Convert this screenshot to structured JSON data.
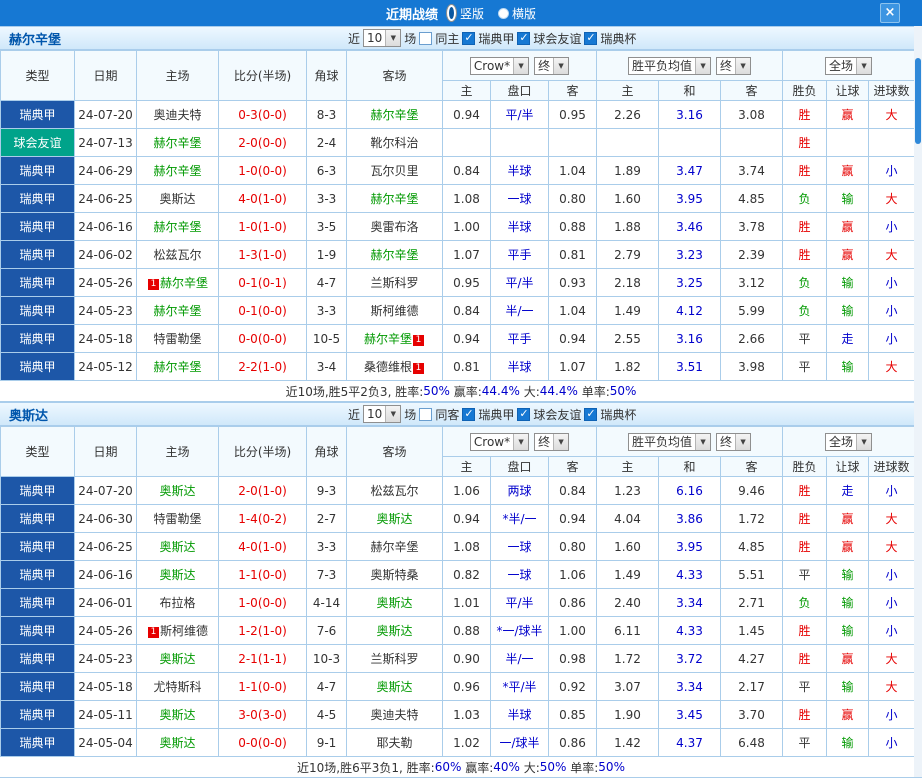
{
  "titlebar": {
    "title": "近期战绩",
    "radios": [
      {
        "label": "竖版",
        "selected": true
      },
      {
        "label": "横版",
        "selected": false
      }
    ],
    "close_label": "×"
  },
  "columns": {
    "type": "类型",
    "date": "日期",
    "home": "主场",
    "score": "比分(半场)",
    "corner": "角球",
    "away": "客场",
    "odds_group": {
      "company": "Crow*",
      "final": "终",
      "sub": [
        "主",
        "盘口",
        "客"
      ]
    },
    "avg_group": {
      "label": "胜平负均值",
      "final": "终",
      "sub": [
        "主",
        "和",
        "客"
      ]
    },
    "result_group": {
      "label": "全场",
      "sub": [
        "胜负",
        "让球",
        "进球数"
      ]
    }
  },
  "sections": [
    {
      "team": "赫尔辛堡",
      "filters": {
        "near": "近",
        "near_value": "10",
        "games": "场",
        "same": {
          "label": "同主",
          "checked": false
        },
        "leagues": [
          {
            "label": "瑞典甲",
            "checked": true
          },
          {
            "label": "球会友谊",
            "checked": true
          },
          {
            "label": "瑞典杯",
            "checked": true
          }
        ]
      },
      "rows": [
        {
          "type": "瑞典甲",
          "type_style": "league",
          "date": "24-07-20",
          "home": {
            "n": "奥迪夫特",
            "f": false
          },
          "score": "0-3(0-0)",
          "corner": "8-3",
          "away": {
            "n": "赫尔辛堡",
            "f": true
          },
          "odds": [
            "0.94",
            "平/半",
            "0.95"
          ],
          "avg": [
            "2.26",
            "3.16",
            "3.08"
          ],
          "result": {
            "t": "胜",
            "c": "red"
          },
          "hcp": {
            "t": "赢",
            "c": "red"
          },
          "goals": {
            "t": "大",
            "c": "red"
          }
        },
        {
          "type": "球会友谊",
          "type_style": "friendly",
          "date": "24-07-13",
          "home": {
            "n": "赫尔辛堡",
            "f": true
          },
          "score": "2-0(0-0)",
          "corner": "2-4",
          "away": {
            "n": "靴尔科治",
            "f": false
          },
          "odds": [
            "",
            "",
            ""
          ],
          "avg": [
            "",
            "",
            ""
          ],
          "result": {
            "t": "胜",
            "c": "red"
          },
          "hcp": {
            "t": "",
            "c": "black"
          },
          "goals": {
            "t": "",
            "c": "black"
          }
        },
        {
          "type": "瑞典甲",
          "type_style": "league",
          "date": "24-06-29",
          "home": {
            "n": "赫尔辛堡",
            "f": true
          },
          "score": "1-0(0-0)",
          "corner": "6-3",
          "away": {
            "n": "瓦尔贝里",
            "f": false
          },
          "odds": [
            "0.84",
            "半球",
            "1.04"
          ],
          "avg": [
            "1.89",
            "3.47",
            "3.74"
          ],
          "result": {
            "t": "胜",
            "c": "red"
          },
          "hcp": {
            "t": "赢",
            "c": "red"
          },
          "goals": {
            "t": "小",
            "c": "blue"
          }
        },
        {
          "type": "瑞典甲",
          "type_style": "league",
          "date": "24-06-25",
          "home": {
            "n": "奥斯达",
            "f": false
          },
          "score": "4-0(1-0)",
          "corner": "3-3",
          "away": {
            "n": "赫尔辛堡",
            "f": true
          },
          "odds": [
            "1.08",
            "一球",
            "0.80"
          ],
          "avg": [
            "1.60",
            "3.95",
            "4.85"
          ],
          "result": {
            "t": "负",
            "c": "green"
          },
          "hcp": {
            "t": "输",
            "c": "green"
          },
          "goals": {
            "t": "大",
            "c": "red"
          }
        },
        {
          "type": "瑞典甲",
          "type_style": "league",
          "date": "24-06-16",
          "home": {
            "n": "赫尔辛堡",
            "f": true
          },
          "score": "1-0(1-0)",
          "corner": "3-5",
          "away": {
            "n": "奥雷布洛",
            "f": false
          },
          "odds": [
            "1.00",
            "半球",
            "0.88"
          ],
          "avg": [
            "1.88",
            "3.46",
            "3.78"
          ],
          "result": {
            "t": "胜",
            "c": "red"
          },
          "hcp": {
            "t": "赢",
            "c": "red"
          },
          "goals": {
            "t": "小",
            "c": "blue"
          }
        },
        {
          "type": "瑞典甲",
          "type_style": "league",
          "date": "24-06-02",
          "home": {
            "n": "松兹瓦尔",
            "f": false
          },
          "score": "1-3(1-0)",
          "corner": "1-9",
          "away": {
            "n": "赫尔辛堡",
            "f": true
          },
          "odds": [
            "1.07",
            "平手",
            "0.81"
          ],
          "avg": [
            "2.79",
            "3.23",
            "2.39"
          ],
          "result": {
            "t": "胜",
            "c": "red"
          },
          "hcp": {
            "t": "赢",
            "c": "red"
          },
          "goals": {
            "t": "大",
            "c": "red"
          }
        },
        {
          "type": "瑞典甲",
          "type_style": "league",
          "date": "24-05-26",
          "home": {
            "n": "赫尔辛堡",
            "f": true,
            "b": "1",
            "bp": "before"
          },
          "score": "0-1(0-1)",
          "corner": "4-7",
          "away": {
            "n": "兰斯科罗",
            "f": false
          },
          "odds": [
            "0.95",
            "平/半",
            "0.93"
          ],
          "avg": [
            "2.18",
            "3.25",
            "3.12"
          ],
          "result": {
            "t": "负",
            "c": "green"
          },
          "hcp": {
            "t": "输",
            "c": "green"
          },
          "goals": {
            "t": "小",
            "c": "blue"
          }
        },
        {
          "type": "瑞典甲",
          "type_style": "league",
          "date": "24-05-23",
          "home": {
            "n": "赫尔辛堡",
            "f": true
          },
          "score": "0-1(0-0)",
          "corner": "3-3",
          "away": {
            "n": "斯柯维德",
            "f": false
          },
          "odds": [
            "0.84",
            "半/一",
            "1.04"
          ],
          "avg": [
            "1.49",
            "4.12",
            "5.99"
          ],
          "result": {
            "t": "负",
            "c": "green"
          },
          "hcp": {
            "t": "输",
            "c": "green"
          },
          "goals": {
            "t": "小",
            "c": "blue"
          }
        },
        {
          "type": "瑞典甲",
          "type_style": "league",
          "date": "24-05-18",
          "home": {
            "n": "特雷勒堡",
            "f": false
          },
          "score": "0-0(0-0)",
          "corner": "10-5",
          "away": {
            "n": "赫尔辛堡",
            "f": true,
            "b": "1",
            "bp": "after"
          },
          "odds": [
            "0.94",
            "平手",
            "0.94"
          ],
          "avg": [
            "2.55",
            "3.16",
            "2.66"
          ],
          "result": {
            "t": "平",
            "c": "black"
          },
          "hcp": {
            "t": "走",
            "c": "blue"
          },
          "goals": {
            "t": "小",
            "c": "blue"
          }
        },
        {
          "type": "瑞典甲",
          "type_style": "league",
          "date": "24-05-12",
          "home": {
            "n": "赫尔辛堡",
            "f": true
          },
          "score": "2-2(1-0)",
          "corner": "3-4",
          "away": {
            "n": "桑德维根",
            "f": false,
            "b": "1",
            "bp": "after"
          },
          "odds": [
            "0.81",
            "半球",
            "1.07"
          ],
          "avg": [
            "1.82",
            "3.51",
            "3.98"
          ],
          "result": {
            "t": "平",
            "c": "black"
          },
          "hcp": {
            "t": "输",
            "c": "green"
          },
          "goals": {
            "t": "大",
            "c": "red"
          }
        }
      ],
      "summary": [
        {
          "text": "近10场,胜5平2负3, 胜率:",
          "color": "black"
        },
        {
          "text": "50%",
          "color": "blue"
        },
        {
          "text": " 赢率:",
          "color": "black"
        },
        {
          "text": "44.4%",
          "color": "blue"
        },
        {
          "text": " 大:",
          "color": "black"
        },
        {
          "text": "44.4%",
          "color": "blue"
        },
        {
          "text": " 单率:",
          "color": "black"
        },
        {
          "text": "50%",
          "color": "blue"
        }
      ]
    },
    {
      "team": "奥斯达",
      "filters": {
        "near": "近",
        "near_value": "10",
        "games": "场",
        "same": {
          "label": "同客",
          "checked": false
        },
        "leagues": [
          {
            "label": "瑞典甲",
            "checked": true
          },
          {
            "label": "球会友谊",
            "checked": true
          },
          {
            "label": "瑞典杯",
            "checked": true
          }
        ]
      },
      "rows": [
        {
          "type": "瑞典甲",
          "type_style": "league",
          "date": "24-07-20",
          "home": {
            "n": "奥斯达",
            "f": true
          },
          "score": "2-0(1-0)",
          "corner": "9-3",
          "away": {
            "n": "松兹瓦尔",
            "f": false
          },
          "odds": [
            "1.06",
            "两球",
            "0.84"
          ],
          "avg": [
            "1.23",
            "6.16",
            "9.46"
          ],
          "result": {
            "t": "胜",
            "c": "red"
          },
          "hcp": {
            "t": "走",
            "c": "blue"
          },
          "goals": {
            "t": "小",
            "c": "blue"
          }
        },
        {
          "type": "瑞典甲",
          "type_style": "league",
          "date": "24-06-30",
          "home": {
            "n": "特雷勒堡",
            "f": false
          },
          "score": "1-4(0-2)",
          "corner": "2-7",
          "away": {
            "n": "奥斯达",
            "f": true
          },
          "odds": [
            "0.94",
            "*半/一",
            "0.94"
          ],
          "avg": [
            "4.04",
            "3.86",
            "1.72"
          ],
          "result": {
            "t": "胜",
            "c": "red"
          },
          "hcp": {
            "t": "赢",
            "c": "red"
          },
          "goals": {
            "t": "大",
            "c": "red"
          }
        },
        {
          "type": "瑞典甲",
          "type_style": "league",
          "date": "24-06-25",
          "home": {
            "n": "奥斯达",
            "f": true
          },
          "score": "4-0(1-0)",
          "corner": "3-3",
          "away": {
            "n": "赫尔辛堡",
            "f": false
          },
          "odds": [
            "1.08",
            "一球",
            "0.80"
          ],
          "avg": [
            "1.60",
            "3.95",
            "4.85"
          ],
          "result": {
            "t": "胜",
            "c": "red"
          },
          "hcp": {
            "t": "赢",
            "c": "red"
          },
          "goals": {
            "t": "大",
            "c": "red"
          }
        },
        {
          "type": "瑞典甲",
          "type_style": "league",
          "date": "24-06-16",
          "home": {
            "n": "奥斯达",
            "f": true
          },
          "score": "1-1(0-0)",
          "corner": "7-3",
          "away": {
            "n": "奥斯特桑",
            "f": false
          },
          "odds": [
            "0.82",
            "一球",
            "1.06"
          ],
          "avg": [
            "1.49",
            "4.33",
            "5.51"
          ],
          "result": {
            "t": "平",
            "c": "black"
          },
          "hcp": {
            "t": "输",
            "c": "green"
          },
          "goals": {
            "t": "小",
            "c": "blue"
          }
        },
        {
          "type": "瑞典甲",
          "type_style": "league",
          "date": "24-06-01",
          "home": {
            "n": "布拉格",
            "f": false
          },
          "score": "1-0(0-0)",
          "corner": "4-14",
          "away": {
            "n": "奥斯达",
            "f": true
          },
          "odds": [
            "1.01",
            "平/半",
            "0.86"
          ],
          "avg": [
            "2.40",
            "3.34",
            "2.71"
          ],
          "result": {
            "t": "负",
            "c": "green"
          },
          "hcp": {
            "t": "输",
            "c": "green"
          },
          "goals": {
            "t": "小",
            "c": "blue"
          }
        },
        {
          "type": "瑞典甲",
          "type_style": "league",
          "date": "24-05-26",
          "home": {
            "n": "斯柯维德",
            "f": false,
            "b": "1",
            "bp": "before"
          },
          "score": "1-2(1-0)",
          "corner": "7-6",
          "away": {
            "n": "奥斯达",
            "f": true
          },
          "odds": [
            "0.88",
            "*一/球半",
            "1.00"
          ],
          "avg": [
            "6.11",
            "4.33",
            "1.45"
          ],
          "result": {
            "t": "胜",
            "c": "red"
          },
          "hcp": {
            "t": "输",
            "c": "green"
          },
          "goals": {
            "t": "小",
            "c": "blue"
          }
        },
        {
          "type": "瑞典甲",
          "type_style": "league",
          "date": "24-05-23",
          "home": {
            "n": "奥斯达",
            "f": true
          },
          "score": "2-1(1-1)",
          "corner": "10-3",
          "away": {
            "n": "兰斯科罗",
            "f": false
          },
          "odds": [
            "0.90",
            "半/一",
            "0.98"
          ],
          "avg": [
            "1.72",
            "3.72",
            "4.27"
          ],
          "result": {
            "t": "胜",
            "c": "red"
          },
          "hcp": {
            "t": "赢",
            "c": "red"
          },
          "goals": {
            "t": "大",
            "c": "red"
          }
        },
        {
          "type": "瑞典甲",
          "type_style": "league",
          "date": "24-05-18",
          "home": {
            "n": "尤特斯科",
            "f": false
          },
          "score": "1-1(0-0)",
          "corner": "4-7",
          "away": {
            "n": "奥斯达",
            "f": true
          },
          "odds": [
            "0.96",
            "*平/半",
            "0.92"
          ],
          "avg": [
            "3.07",
            "3.34",
            "2.17"
          ],
          "result": {
            "t": "平",
            "c": "black"
          },
          "hcp": {
            "t": "输",
            "c": "green"
          },
          "goals": {
            "t": "大",
            "c": "red"
          }
        },
        {
          "type": "瑞典甲",
          "type_style": "league",
          "date": "24-05-11",
          "home": {
            "n": "奥斯达",
            "f": true
          },
          "score": "3-0(3-0)",
          "corner": "4-5",
          "away": {
            "n": "奥迪夫特",
            "f": false
          },
          "odds": [
            "1.03",
            "半球",
            "0.85"
          ],
          "avg": [
            "1.90",
            "3.45",
            "3.70"
          ],
          "result": {
            "t": "胜",
            "c": "red"
          },
          "hcp": {
            "t": "赢",
            "c": "red"
          },
          "goals": {
            "t": "小",
            "c": "blue"
          }
        },
        {
          "type": "瑞典甲",
          "type_style": "league",
          "date": "24-05-04",
          "home": {
            "n": "奥斯达",
            "f": true
          },
          "score": "0-0(0-0)",
          "corner": "9-1",
          "away": {
            "n": "耶夫勒",
            "f": false
          },
          "odds": [
            "1.02",
            "一/球半",
            "0.86"
          ],
          "avg": [
            "1.42",
            "4.37",
            "6.48"
          ],
          "result": {
            "t": "平",
            "c": "black"
          },
          "hcp": {
            "t": "输",
            "c": "green"
          },
          "goals": {
            "t": "小",
            "c": "blue"
          }
        }
      ],
      "summary": [
        {
          "text": "近10场,胜6平3负1, 胜率:",
          "color": "black"
        },
        {
          "text": "60%",
          "color": "blue"
        },
        {
          "text": " 赢率:",
          "color": "black"
        },
        {
          "text": "40%",
          "color": "blue"
        },
        {
          "text": " 大:",
          "color": "black"
        },
        {
          "text": "50%",
          "color": "blue"
        },
        {
          "text": " 单率:",
          "color": "black"
        },
        {
          "text": "50%",
          "color": "blue"
        }
      ]
    }
  ]
}
